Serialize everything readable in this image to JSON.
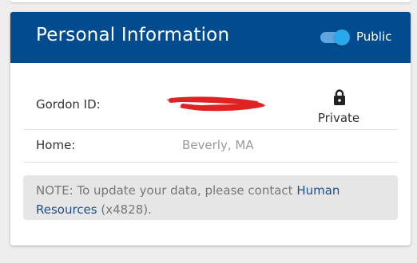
{
  "card": {
    "title": "Personal Information",
    "visibility_toggle": {
      "label": "Public",
      "on": true,
      "color": "#29a8ee"
    },
    "header_color": "#014b8f"
  },
  "rows": [
    {
      "label": "Gordon ID:",
      "value_redacted": true,
      "privacy_icon": "lock-icon",
      "privacy_label": "Private"
    },
    {
      "label": "Home:",
      "value": "Beverly, MA"
    }
  ],
  "note": {
    "prefix": "NOTE: To update your data, please contact ",
    "link_text": "Human Resources",
    "suffix": " (x4828)."
  }
}
